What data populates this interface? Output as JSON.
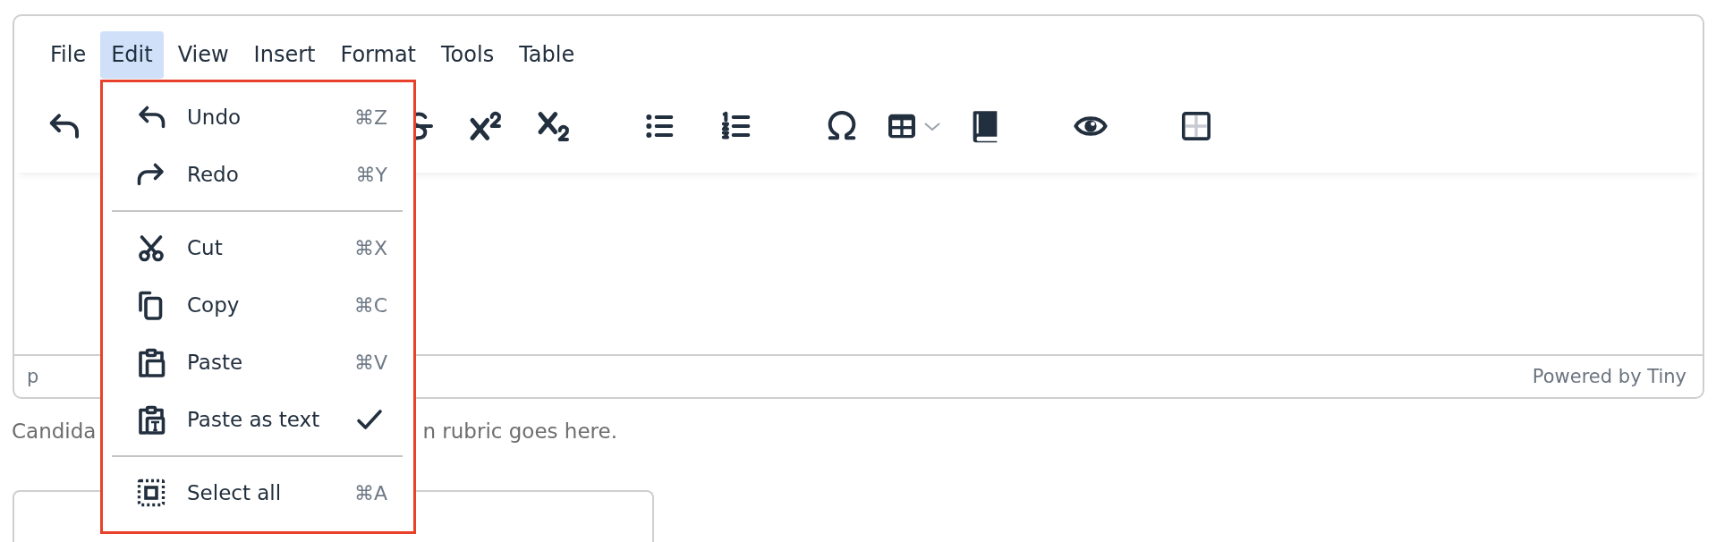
{
  "menubar": [
    {
      "label": "File",
      "selected": false
    },
    {
      "label": "Edit",
      "selected": true
    },
    {
      "label": "View",
      "selected": false
    },
    {
      "label": "Insert",
      "selected": false
    },
    {
      "label": "Format",
      "selected": false
    },
    {
      "label": "Tools",
      "selected": false
    },
    {
      "label": "Table",
      "selected": false
    }
  ],
  "toolbar": {
    "groups": [
      [
        {
          "kind": "undo"
        }
      ],
      [
        {
          "kind": "strikethrough"
        },
        {
          "kind": "superscript"
        },
        {
          "kind": "subscript"
        }
      ],
      [
        {
          "kind": "bullet-list"
        },
        {
          "kind": "numbered-list"
        }
      ],
      [
        {
          "kind": "omega"
        },
        {
          "kind": "table"
        },
        {
          "kind": "book"
        }
      ],
      [
        {
          "kind": "eye"
        }
      ],
      [
        {
          "kind": "grid"
        }
      ]
    ]
  },
  "edit_menu": {
    "items": [
      {
        "kind": "undo",
        "label": "Undo",
        "shortcut": "⌘Z",
        "checked": false
      },
      {
        "kind": "redo",
        "label": "Redo",
        "shortcut": "⌘Y",
        "checked": false
      },
      {
        "kind": "separator"
      },
      {
        "kind": "cut",
        "label": "Cut",
        "shortcut": "⌘X",
        "checked": false
      },
      {
        "kind": "copy",
        "label": "Copy",
        "shortcut": "⌘C",
        "checked": false
      },
      {
        "kind": "paste",
        "label": "Paste",
        "shortcut": "⌘V",
        "checked": false
      },
      {
        "kind": "paste-text",
        "label": "Paste as text",
        "checked": true
      },
      {
        "kind": "separator"
      },
      {
        "kind": "select-all",
        "label": "Select all",
        "shortcut": "⌘A",
        "checked": false
      }
    ]
  },
  "status_bar": {
    "path": "p",
    "branding": "Powered by Tiny"
  },
  "caption": [
    "Candida",
    "n rubric goes here."
  ]
}
